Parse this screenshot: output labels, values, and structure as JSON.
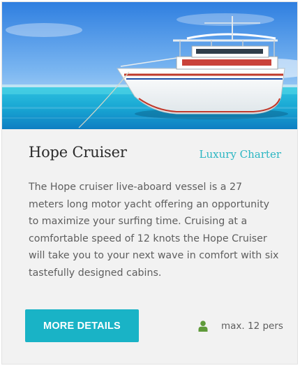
{
  "listing": {
    "image_alt": "Boat on turquoise water",
    "title": "Hope Cruiser",
    "category": "Luxury Charter",
    "description": "The Hope cruiser live-aboard vessel is a 27 meters long motor yacht offering an opportunity to maximize your surfing time. Cruising at a comfortable speed of 12 knots the Hope Cruiser will take you to your next wave in comfort with six tastefully designed cabins.",
    "more_button_label": "MORE DETAILS",
    "capacity_icon": "person-icon",
    "capacity_text": "max. 12 pers"
  },
  "colors": {
    "accent": "#19b3c6",
    "category_text": "#2bb6c2",
    "person_icon": "#5f9a3a",
    "card_background": "#f2f2f2"
  }
}
